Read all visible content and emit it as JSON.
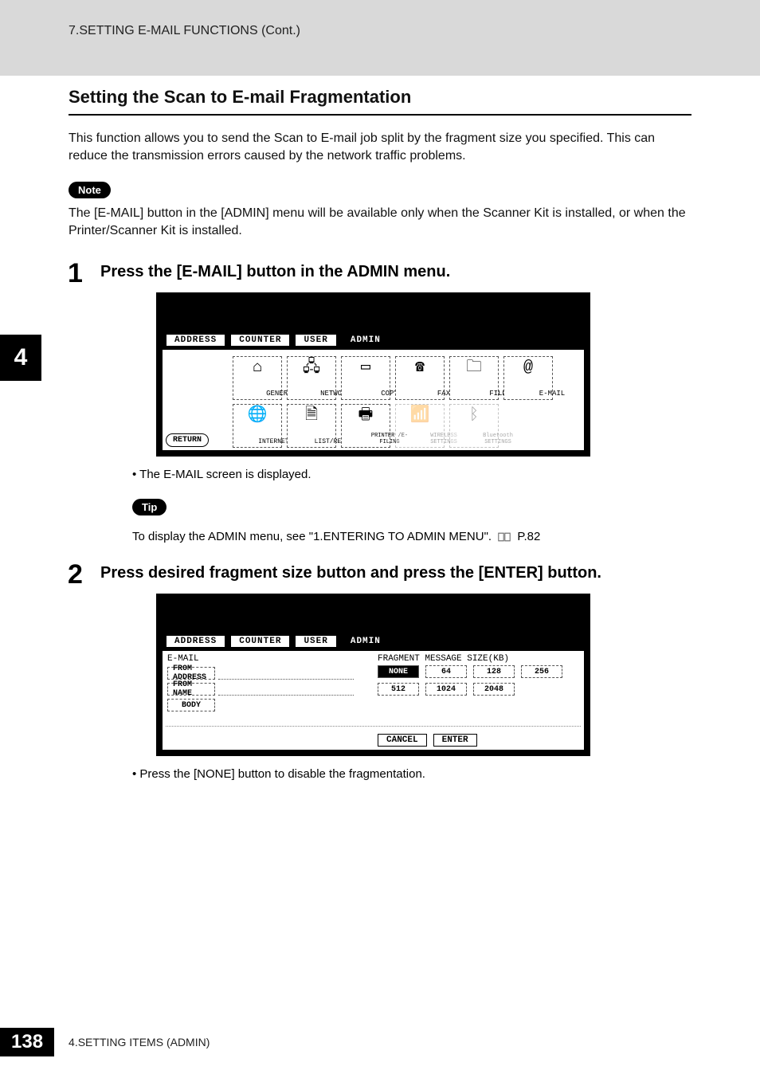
{
  "header": {
    "running": "7.SETTING E-MAIL FUNCTIONS (Cont.)"
  },
  "sidetab": "4",
  "section": {
    "title": "Setting the Scan to E-mail Fragmentation",
    "intro": "This function allows you to send the Scan to E-mail job split by the fragment size you specified.  This can reduce the transmission errors caused by the network traffic problems.",
    "note_badge": "Note",
    "note_text": "The [E-MAIL] button in the [ADMIN] menu will be available only when the Scanner Kit is installed, or when the Printer/Scanner Kit is installed.",
    "tip_badge": "Tip",
    "tip_text": "To display the ADMIN menu, see \"1.ENTERING TO ADMIN MENU\".",
    "tip_page": "P.82"
  },
  "steps": [
    {
      "num": "1",
      "title": "Press the [E-MAIL] button in the ADMIN menu.",
      "bullet": "The E-MAIL screen is displayed."
    },
    {
      "num": "2",
      "title": "Press desired fragment size button and press the [ENTER] button.",
      "bullet": "Press the [NONE] button to disable the fragmentation."
    }
  ],
  "screenshot1": {
    "tabs": [
      "ADDRESS",
      "COUNTER",
      "USER",
      "ADMIN"
    ],
    "active_tab": "ADMIN",
    "row1": [
      {
        "label": "GENERAL",
        "dim": false
      },
      {
        "label": "NETWORK",
        "dim": false
      },
      {
        "label": "COPY",
        "dim": false
      },
      {
        "label": "FAX",
        "dim": false
      },
      {
        "label": "FILE",
        "dim": false
      },
      {
        "label": "E-MAIL",
        "dim": false
      }
    ],
    "row2": [
      {
        "label": "INTERNET FAX",
        "dim": false
      },
      {
        "label": "LIST/REPORT",
        "dim": false
      },
      {
        "label": "PRINTER /E-FILING",
        "dim": false
      },
      {
        "label": "WIRELESS SETTINGS",
        "dim": true
      },
      {
        "label": "Bluetooth SETTINGS",
        "dim": true
      }
    ],
    "return": "RETURN"
  },
  "screenshot2": {
    "tabs": [
      "ADDRESS",
      "COUNTER",
      "USER",
      "ADMIN"
    ],
    "active_tab": "ADMIN",
    "heading_left": "E-MAIL",
    "left_buttons": [
      "FROM ADDRESS",
      "FROM NAME",
      "BODY"
    ],
    "heading_right": "FRAGMENT MESSAGE SIZE(KB)",
    "size_row1": [
      "NONE",
      "64",
      "128",
      "256"
    ],
    "size_row2": [
      "512",
      "1024",
      "2048"
    ],
    "selected_size": "NONE",
    "dialog_buttons": [
      "CANCEL",
      "ENTER"
    ]
  },
  "footer": {
    "page": "138",
    "text": "4.SETTING ITEMS (ADMIN)"
  }
}
